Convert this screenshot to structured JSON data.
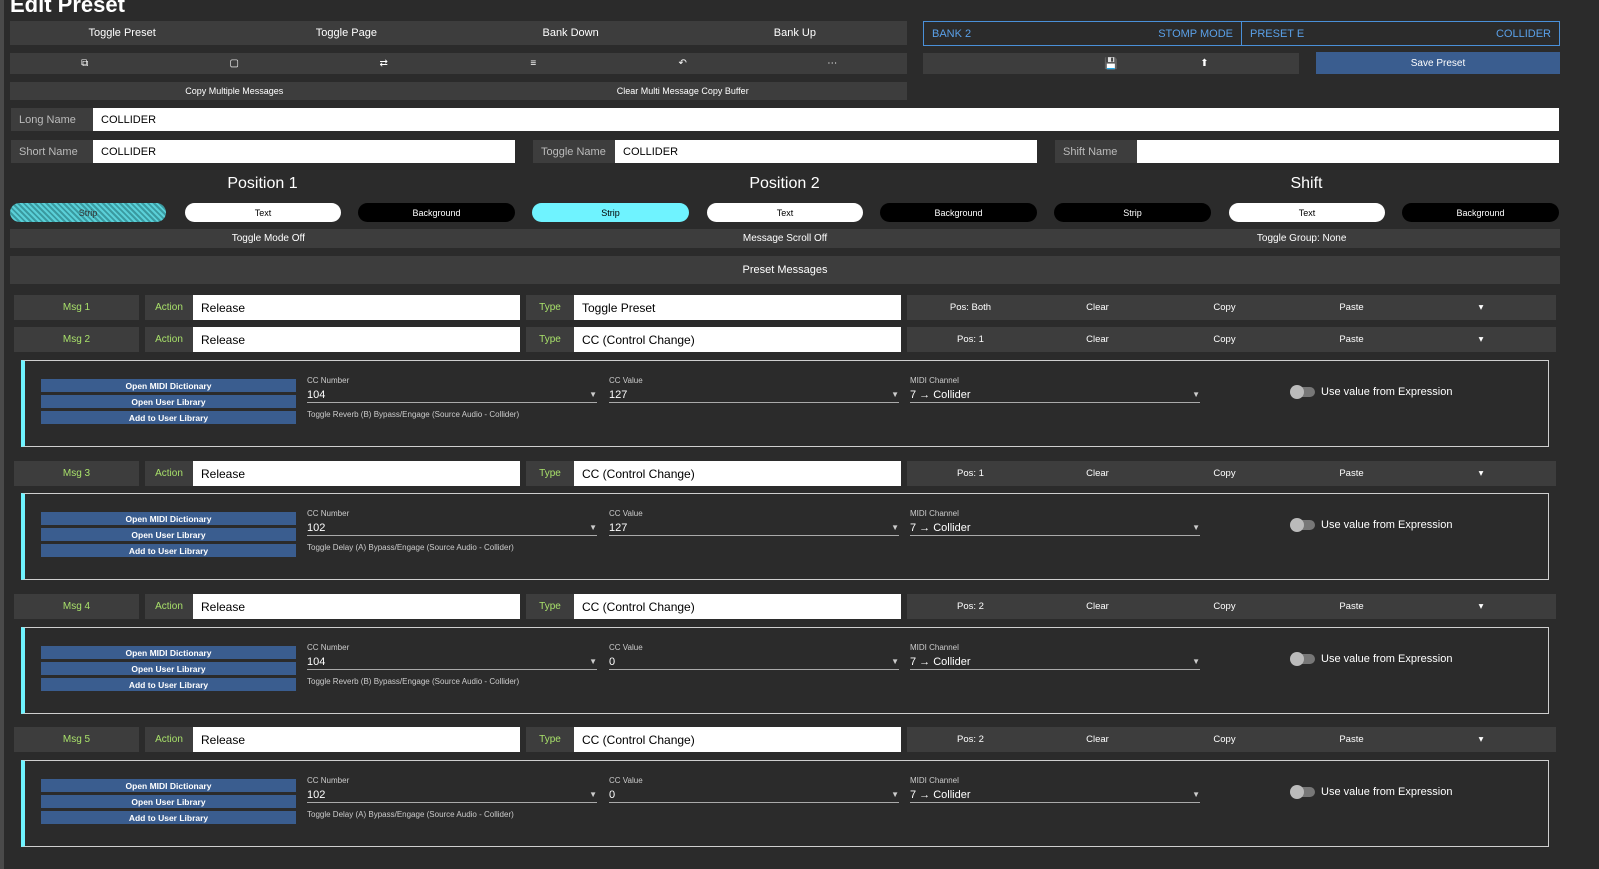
{
  "page_title": "Edit Preset",
  "toolbar": [
    "Toggle Preset",
    "Toggle Page",
    "Bank Down",
    "Bank Up"
  ],
  "icon_toolbar": [
    {
      "icon": "copy-icon",
      "glyph": "⧉"
    },
    {
      "icon": "clipboard-icon",
      "glyph": "▢"
    },
    {
      "icon": "swap-icon",
      "glyph": "⇄"
    },
    {
      "icon": "list-icon",
      "glyph": "≡"
    },
    {
      "icon": "undo-icon",
      "glyph": "↶"
    },
    {
      "icon": "more-icon",
      "glyph": "⋯"
    }
  ],
  "copy_row": [
    "Copy Multiple Messages",
    "Clear Multi Message Copy Buffer"
  ],
  "bank": {
    "bank": "BANK 2",
    "mode": "STOMP MODE",
    "preset": "PRESET E",
    "preset_name": "COLLIDER"
  },
  "save_row": {
    "save_icon": "💾",
    "upload_icon": "⬆",
    "save_label": "Save Preset"
  },
  "colors": {
    "accent_blue": "#3a5d8f",
    "cyan": "#6ff3ff",
    "msg_green": "#a8e06a"
  },
  "names": {
    "long_label": "Long Name",
    "long_value": "COLLIDER",
    "short_label": "Short Name",
    "short_value": "COLLIDER",
    "toggle_label": "Toggle Name",
    "toggle_value": "COLLIDER",
    "shift_label": "Shift Name",
    "shift_value": ""
  },
  "positions": [
    {
      "title": "Position 1",
      "strip": "Strip",
      "text": "Text",
      "background": "Background"
    },
    {
      "title": "Position 2",
      "strip": "Strip",
      "text": "Text",
      "background": "Background"
    },
    {
      "title": "Shift",
      "strip": "Strip",
      "text": "Text",
      "background": "Background"
    }
  ],
  "modes": [
    "Toggle Mode Off",
    "Message Scroll Off",
    "Toggle Group: None"
  ],
  "preset_messages_label": "Preset Messages",
  "messages": [
    {
      "name": "Msg 1",
      "action_label": "Action",
      "action": "Release",
      "type_label": "Type",
      "type": "Toggle Preset",
      "pos": "Pos: Both",
      "clear": "Clear",
      "copy": "Copy",
      "paste": "Paste"
    },
    {
      "name": "Msg 2",
      "action_label": "Action",
      "action": "Release",
      "type_label": "Type",
      "type": "CC (Control Change)",
      "pos": "Pos: 1",
      "clear": "Clear",
      "copy": "Copy",
      "paste": "Paste",
      "detail": {
        "dict": "Open MIDI Dictionary",
        "lib": "Open User Library",
        "add": "Add to User Library",
        "cc_num_label": "CC Number",
        "cc_num": "104",
        "cc_val_label": "CC Value",
        "cc_val": "127",
        "chan_label": "MIDI Channel",
        "chan": "7 → Collider",
        "desc": "Toggle Reverb (B) Bypass/Engage (Source Audio - Collider)",
        "expr": "Use value from Expression"
      }
    },
    {
      "name": "Msg 3",
      "action_label": "Action",
      "action": "Release",
      "type_label": "Type",
      "type": "CC (Control Change)",
      "pos": "Pos: 1",
      "clear": "Clear",
      "copy": "Copy",
      "paste": "Paste",
      "detail": {
        "dict": "Open MIDI Dictionary",
        "lib": "Open User Library",
        "add": "Add to User Library",
        "cc_num_label": "CC Number",
        "cc_num": "102",
        "cc_val_label": "CC Value",
        "cc_val": "127",
        "chan_label": "MIDI Channel",
        "chan": "7 → Collider",
        "desc": "Toggle Delay (A) Bypass/Engage (Source Audio - Collider)",
        "expr": "Use value from Expression"
      }
    },
    {
      "name": "Msg 4",
      "action_label": "Action",
      "action": "Release",
      "type_label": "Type",
      "type": "CC (Control Change)",
      "pos": "Pos: 2",
      "clear": "Clear",
      "copy": "Copy",
      "paste": "Paste",
      "detail": {
        "dict": "Open MIDI Dictionary",
        "lib": "Open User Library",
        "add": "Add to User Library",
        "cc_num_label": "CC Number",
        "cc_num": "104",
        "cc_val_label": "CC Value",
        "cc_val": "0",
        "chan_label": "MIDI Channel",
        "chan": "7 → Collider",
        "desc": "Toggle Reverb (B) Bypass/Engage (Source Audio - Collider)",
        "expr": "Use value from Expression"
      }
    },
    {
      "name": "Msg 5",
      "action_label": "Action",
      "action": "Release",
      "type_label": "Type",
      "type": "CC (Control Change)",
      "pos": "Pos: 2",
      "clear": "Clear",
      "copy": "Copy",
      "paste": "Paste",
      "detail": {
        "dict": "Open MIDI Dictionary",
        "lib": "Open User Library",
        "add": "Add to User Library",
        "cc_num_label": "CC Number",
        "cc_num": "102",
        "cc_val_label": "CC Value",
        "cc_val": "0",
        "chan_label": "MIDI Channel",
        "chan": "7 → Collider",
        "desc": "Toggle Delay (A) Bypass/Engage (Source Audio - Collider)",
        "expr": "Use value from Expression"
      }
    }
  ]
}
